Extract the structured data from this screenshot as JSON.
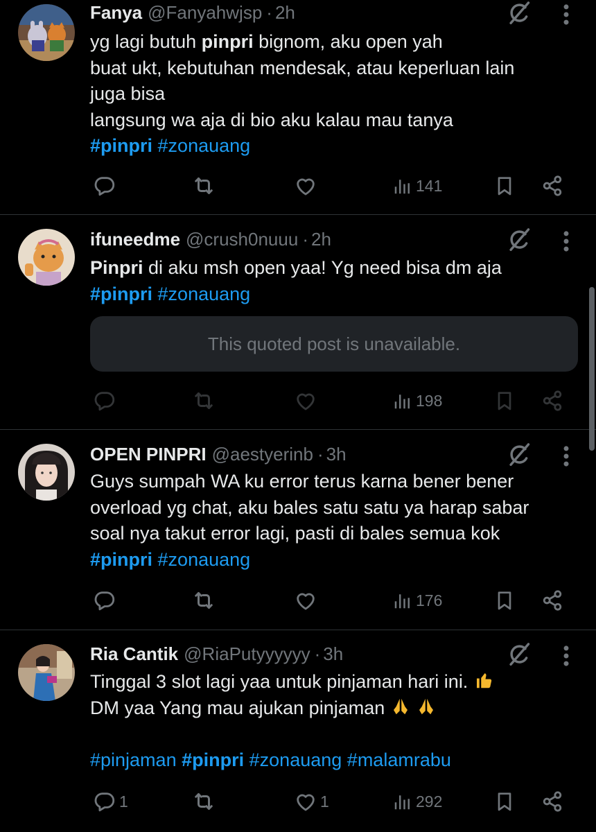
{
  "colors": {
    "background": "#000000",
    "text": "#e7e9ea",
    "muted": "#71767b",
    "accent": "#1d9bf0",
    "divider": "#2f3336",
    "quote_bg": "#202327"
  },
  "icons": {
    "reply": "reply-icon",
    "repost": "repost-icon",
    "like": "like-icon",
    "views": "views-icon",
    "bookmark": "bookmark-icon",
    "share": "share-icon",
    "grok": "grok-icon",
    "more": "more-icon"
  },
  "tweets": [
    {
      "name": "Fanya",
      "handle": "@Fanyahwjsp",
      "sep": "·",
      "time": "2h",
      "lines": [
        [
          "yg lagi butuh ",
          "pinpri",
          " bignom, aku open yah"
        ],
        "buat ukt, kebutuhan mendesak, atau keperluan lain",
        "juga bisa",
        "langsung wa aja di bio aku kalau mau tanya"
      ],
      "tags": [
        "#pinpri",
        "#zonauang"
      ],
      "replies": "",
      "reposts": "",
      "likes": "",
      "views": "141"
    },
    {
      "name": "ifuneedme",
      "handle": "@crush0nuuu",
      "sep": "·",
      "time": "2h",
      "lines": [
        [
          "",
          "Pinpri",
          " di aku msh open yaa! Yg need bisa dm aja"
        ]
      ],
      "tags": [
        "#pinpri",
        "#zonauang"
      ],
      "quoted": "This quoted post is unavailable.",
      "replies": "",
      "reposts": "",
      "likes": "",
      "views": "198"
    },
    {
      "name": "OPEN PINPRI",
      "handle": "@aestyerinb",
      "sep": "·",
      "time": "3h",
      "lines": [
        "Guys sumpah WA ku error terus karna bener bener",
        "overload yg chat, aku bales satu satu ya harap sabar",
        "soal nya takut error lagi, pasti di bales semua kok"
      ],
      "tags": [
        "#pinpri",
        "#zonauang"
      ],
      "replies": "",
      "reposts": "",
      "likes": "",
      "views": "176"
    },
    {
      "name": "Ria Cantik",
      "handle": "@RiaPutyyyyyy",
      "sep": "·",
      "time": "3h",
      "lines": [
        "Tinggal 3 slot lagi yaa untuk pinjaman hari ini.",
        "DM yaa Yang mau ajukan pinjaman"
      ],
      "tags": [
        "#pinjaman",
        "#pinpri",
        "#zonauang",
        "#malamrabu"
      ],
      "replies": "1",
      "reposts": "",
      "likes": "1",
      "views": "292"
    }
  ]
}
